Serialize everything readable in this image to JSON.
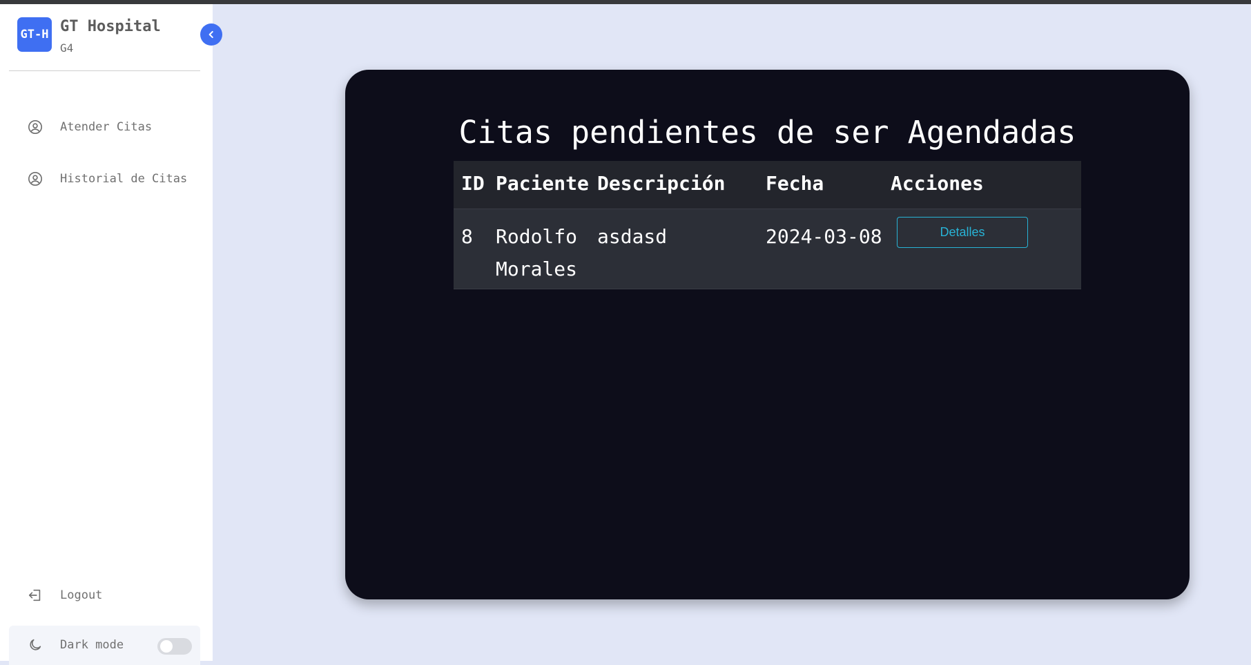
{
  "sidebar": {
    "logo_text": "GT-H",
    "app_name": "GT Hospital",
    "app_sub": "G4",
    "nav": [
      {
        "label": "Atender Citas",
        "icon": "user-circle-icon"
      },
      {
        "label": "Historial de Citas",
        "icon": "user-circle-icon"
      }
    ],
    "logout_label": "Logout",
    "dark_mode_label": "Dark mode",
    "dark_mode_on": false
  },
  "main": {
    "title": "Citas pendientes de ser Agendadas",
    "table": {
      "headers": [
        "ID",
        "Paciente",
        "Descripción",
        "Fecha",
        "Acciones"
      ],
      "rows": [
        {
          "id": "8",
          "paciente_first": "Rodolfo",
          "paciente_last": "Morales",
          "descripcion": "asdasd",
          "fecha": "2024-03-08",
          "accion": "Detalles"
        }
      ]
    }
  },
  "colors": {
    "accent": "#3f6ff2",
    "card_bg": "#0d0d1a",
    "page_bg": "#e1e6f6",
    "button_outline": "#28b3d6"
  }
}
